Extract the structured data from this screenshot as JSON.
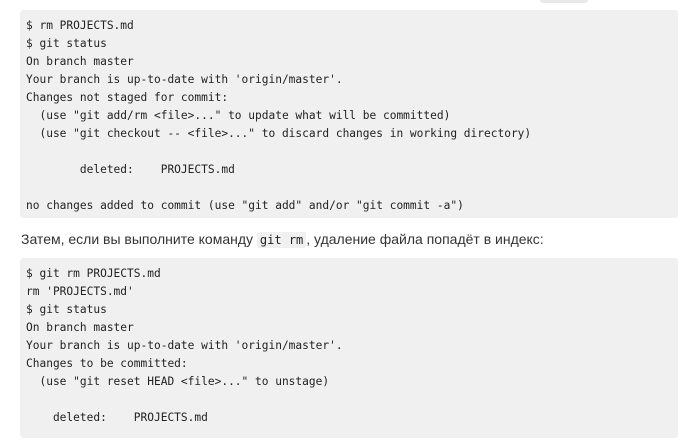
{
  "block1": {
    "lines": [
      "$ rm PROJECTS.md",
      "$ git status",
      "On branch master",
      "Your branch is up-to-date with 'origin/master'.",
      "Changes not staged for commit:",
      "  (use \"git add/rm <file>...\" to update what will be committed)",
      "  (use \"git checkout -- <file>...\" to discard changes in working directory)",
      "",
      "        deleted:    PROJECTS.md",
      "",
      "no changes added to commit (use \"git add\" and/or \"git commit -a\")"
    ]
  },
  "paragraph": {
    "before": "Затем, если вы выполните команду ",
    "code": "git rm",
    "after": ", удаление файла попадёт в индекс:"
  },
  "block2": {
    "lines": [
      "$ git rm PROJECTS.md",
      "rm 'PROJECTS.md'",
      "$ git status",
      "On branch master",
      "Your branch is up-to-date with 'origin/master'.",
      "Changes to be committed:",
      "  (use \"git reset HEAD <file>...\" to unstage)",
      "",
      "    deleted:    PROJECTS.md"
    ]
  }
}
